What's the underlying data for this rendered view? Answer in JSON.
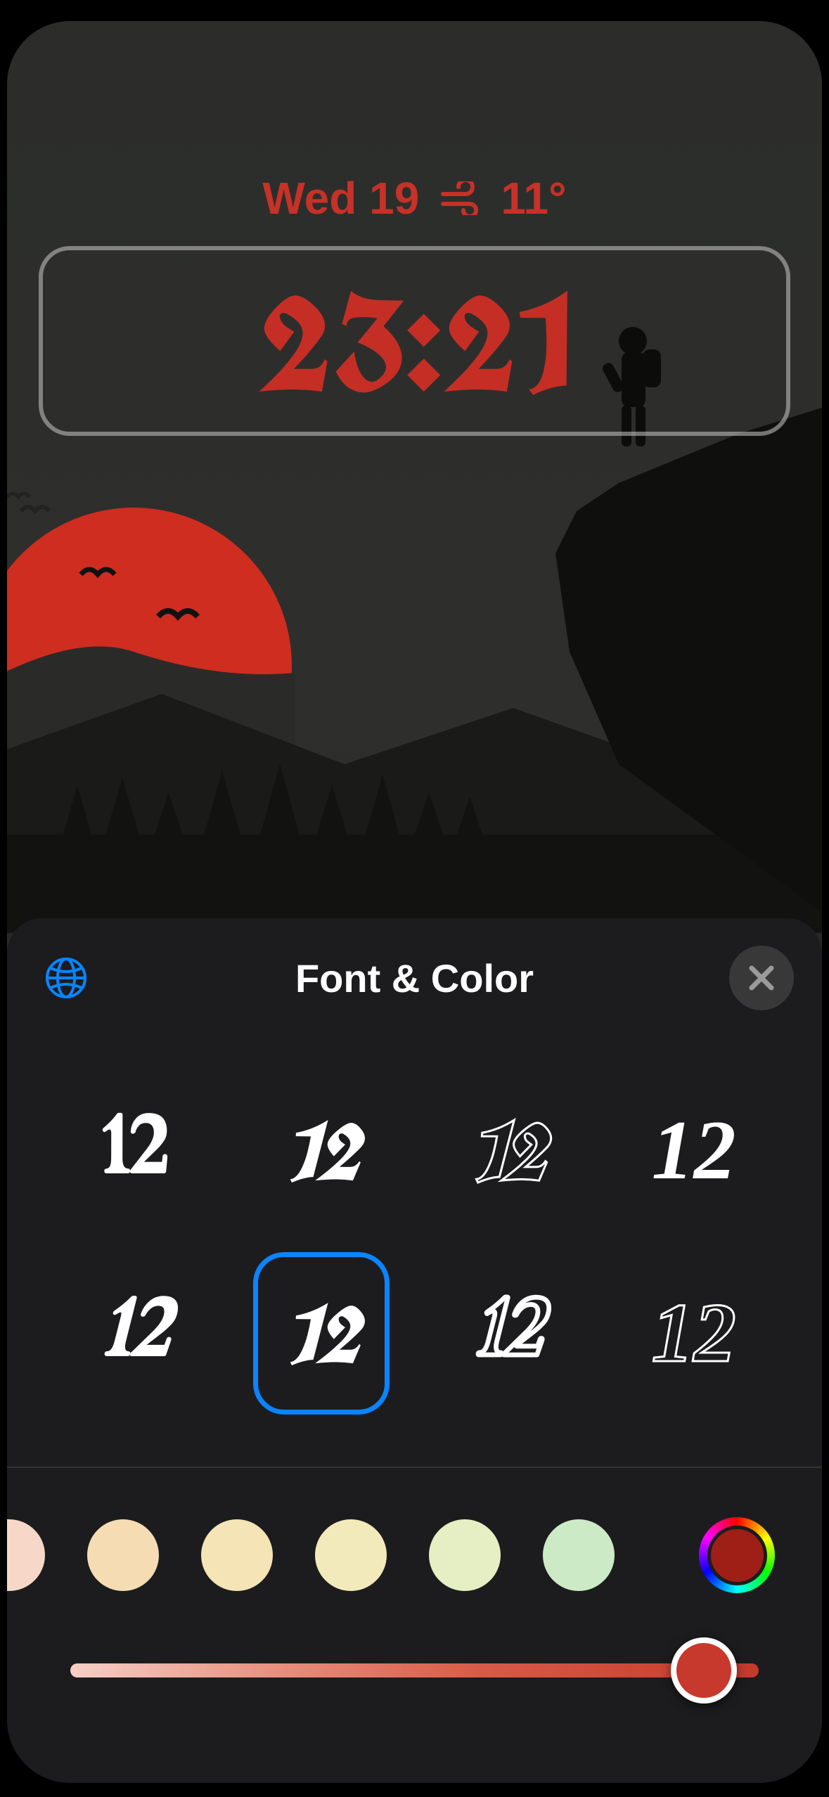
{
  "lockscreen": {
    "date": "Wed 19",
    "weather_temp": "11°",
    "time": "23:21",
    "accent_color": "#c52e25"
  },
  "panel": {
    "title": "Font & Color",
    "font_sample_text": "12",
    "selected_font_index": 5,
    "font_options": [
      {
        "style": "blackletter-bold-a"
      },
      {
        "style": "blackletter-flourish"
      },
      {
        "style": "blackletter-outline-a"
      },
      {
        "style": "serif-italic"
      },
      {
        "style": "blackletter-bold-b"
      },
      {
        "style": "blackletter-ornate-selected"
      },
      {
        "style": "blackletter-outline-thin"
      },
      {
        "style": "blackletter-outline-b"
      }
    ],
    "color_swatches": [
      "#f6d7c8",
      "#f5dcb3",
      "#f4e4b6",
      "#f2eabb",
      "#e6efc3",
      "#cdeac7"
    ],
    "custom_color": "#9f1e16",
    "slider_value": 0.92
  }
}
